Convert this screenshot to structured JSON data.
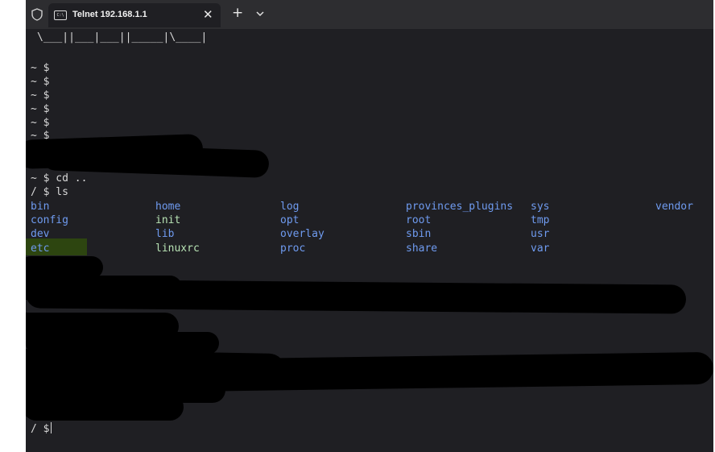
{
  "tab": {
    "title": "Telnet 192.168.1.1",
    "icon": "terminal-icon",
    "close": "✕",
    "new_tab": "+"
  },
  "terminal": {
    "banner": "\\___||___|___||_____|\\____|",
    "prompt_lines": [
      "~ $",
      "~ $",
      "~ $",
      "~ $",
      "~ $",
      "~ $"
    ],
    "cmd_cd": "~ $ cd ..",
    "cmd_ls": "/ $ ls",
    "ls_columns": [
      [
        "bin",
        "config",
        "dev",
        "etc"
      ],
      [
        "home",
        "init",
        "lib",
        "linuxrc"
      ],
      [
        "log",
        "opt",
        "overlay",
        "proc"
      ],
      [
        "provinces_plugins",
        "root",
        "sbin",
        "share"
      ],
      [
        "sys",
        "tmp",
        "usr",
        "var"
      ],
      [
        "vendor"
      ]
    ],
    "final_prompt": "/ $",
    "colors": {
      "background": "#1f1f23",
      "text": "#d8d8d8",
      "directory": "#6f9bf0",
      "executable": "#b8e3b4",
      "selection": "#2d4510"
    }
  }
}
